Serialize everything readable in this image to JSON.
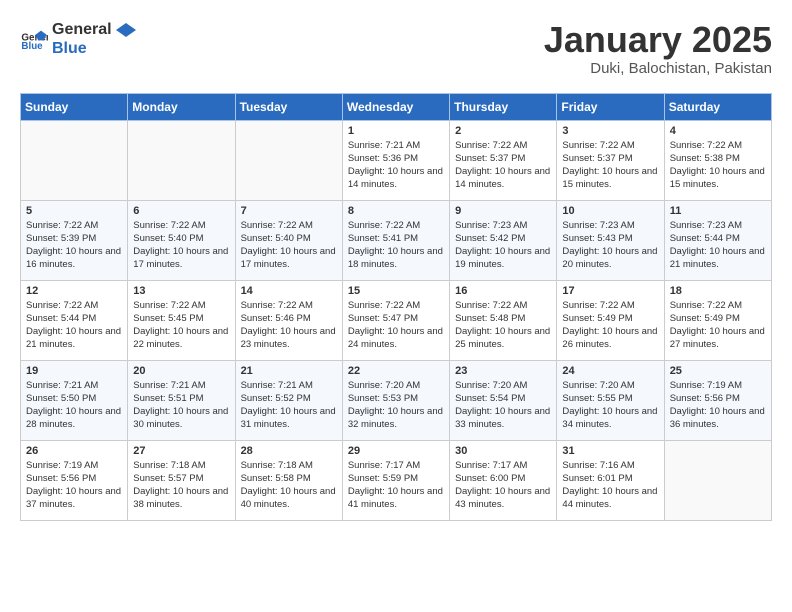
{
  "header": {
    "logo_general": "General",
    "logo_blue": "Blue",
    "title": "January 2025",
    "subtitle": "Duki, Balochistan, Pakistan"
  },
  "weekdays": [
    "Sunday",
    "Monday",
    "Tuesday",
    "Wednesday",
    "Thursday",
    "Friday",
    "Saturday"
  ],
  "weeks": [
    [
      {
        "day": "",
        "sunrise": "",
        "sunset": "",
        "daylight": ""
      },
      {
        "day": "",
        "sunrise": "",
        "sunset": "",
        "daylight": ""
      },
      {
        "day": "",
        "sunrise": "",
        "sunset": "",
        "daylight": ""
      },
      {
        "day": "1",
        "sunrise": "Sunrise: 7:21 AM",
        "sunset": "Sunset: 5:36 PM",
        "daylight": "Daylight: 10 hours and 14 minutes."
      },
      {
        "day": "2",
        "sunrise": "Sunrise: 7:22 AM",
        "sunset": "Sunset: 5:37 PM",
        "daylight": "Daylight: 10 hours and 14 minutes."
      },
      {
        "day": "3",
        "sunrise": "Sunrise: 7:22 AM",
        "sunset": "Sunset: 5:37 PM",
        "daylight": "Daylight: 10 hours and 15 minutes."
      },
      {
        "day": "4",
        "sunrise": "Sunrise: 7:22 AM",
        "sunset": "Sunset: 5:38 PM",
        "daylight": "Daylight: 10 hours and 15 minutes."
      }
    ],
    [
      {
        "day": "5",
        "sunrise": "Sunrise: 7:22 AM",
        "sunset": "Sunset: 5:39 PM",
        "daylight": "Daylight: 10 hours and 16 minutes."
      },
      {
        "day": "6",
        "sunrise": "Sunrise: 7:22 AM",
        "sunset": "Sunset: 5:40 PM",
        "daylight": "Daylight: 10 hours and 17 minutes."
      },
      {
        "day": "7",
        "sunrise": "Sunrise: 7:22 AM",
        "sunset": "Sunset: 5:40 PM",
        "daylight": "Daylight: 10 hours and 17 minutes."
      },
      {
        "day": "8",
        "sunrise": "Sunrise: 7:22 AM",
        "sunset": "Sunset: 5:41 PM",
        "daylight": "Daylight: 10 hours and 18 minutes."
      },
      {
        "day": "9",
        "sunrise": "Sunrise: 7:23 AM",
        "sunset": "Sunset: 5:42 PM",
        "daylight": "Daylight: 10 hours and 19 minutes."
      },
      {
        "day": "10",
        "sunrise": "Sunrise: 7:23 AM",
        "sunset": "Sunset: 5:43 PM",
        "daylight": "Daylight: 10 hours and 20 minutes."
      },
      {
        "day": "11",
        "sunrise": "Sunrise: 7:23 AM",
        "sunset": "Sunset: 5:44 PM",
        "daylight": "Daylight: 10 hours and 21 minutes."
      }
    ],
    [
      {
        "day": "12",
        "sunrise": "Sunrise: 7:22 AM",
        "sunset": "Sunset: 5:44 PM",
        "daylight": "Daylight: 10 hours and 21 minutes."
      },
      {
        "day": "13",
        "sunrise": "Sunrise: 7:22 AM",
        "sunset": "Sunset: 5:45 PM",
        "daylight": "Daylight: 10 hours and 22 minutes."
      },
      {
        "day": "14",
        "sunrise": "Sunrise: 7:22 AM",
        "sunset": "Sunset: 5:46 PM",
        "daylight": "Daylight: 10 hours and 23 minutes."
      },
      {
        "day": "15",
        "sunrise": "Sunrise: 7:22 AM",
        "sunset": "Sunset: 5:47 PM",
        "daylight": "Daylight: 10 hours and 24 minutes."
      },
      {
        "day": "16",
        "sunrise": "Sunrise: 7:22 AM",
        "sunset": "Sunset: 5:48 PM",
        "daylight": "Daylight: 10 hours and 25 minutes."
      },
      {
        "day": "17",
        "sunrise": "Sunrise: 7:22 AM",
        "sunset": "Sunset: 5:49 PM",
        "daylight": "Daylight: 10 hours and 26 minutes."
      },
      {
        "day": "18",
        "sunrise": "Sunrise: 7:22 AM",
        "sunset": "Sunset: 5:49 PM",
        "daylight": "Daylight: 10 hours and 27 minutes."
      }
    ],
    [
      {
        "day": "19",
        "sunrise": "Sunrise: 7:21 AM",
        "sunset": "Sunset: 5:50 PM",
        "daylight": "Daylight: 10 hours and 28 minutes."
      },
      {
        "day": "20",
        "sunrise": "Sunrise: 7:21 AM",
        "sunset": "Sunset: 5:51 PM",
        "daylight": "Daylight: 10 hours and 30 minutes."
      },
      {
        "day": "21",
        "sunrise": "Sunrise: 7:21 AM",
        "sunset": "Sunset: 5:52 PM",
        "daylight": "Daylight: 10 hours and 31 minutes."
      },
      {
        "day": "22",
        "sunrise": "Sunrise: 7:20 AM",
        "sunset": "Sunset: 5:53 PM",
        "daylight": "Daylight: 10 hours and 32 minutes."
      },
      {
        "day": "23",
        "sunrise": "Sunrise: 7:20 AM",
        "sunset": "Sunset: 5:54 PM",
        "daylight": "Daylight: 10 hours and 33 minutes."
      },
      {
        "day": "24",
        "sunrise": "Sunrise: 7:20 AM",
        "sunset": "Sunset: 5:55 PM",
        "daylight": "Daylight: 10 hours and 34 minutes."
      },
      {
        "day": "25",
        "sunrise": "Sunrise: 7:19 AM",
        "sunset": "Sunset: 5:56 PM",
        "daylight": "Daylight: 10 hours and 36 minutes."
      }
    ],
    [
      {
        "day": "26",
        "sunrise": "Sunrise: 7:19 AM",
        "sunset": "Sunset: 5:56 PM",
        "daylight": "Daylight: 10 hours and 37 minutes."
      },
      {
        "day": "27",
        "sunrise": "Sunrise: 7:18 AM",
        "sunset": "Sunset: 5:57 PM",
        "daylight": "Daylight: 10 hours and 38 minutes."
      },
      {
        "day": "28",
        "sunrise": "Sunrise: 7:18 AM",
        "sunset": "Sunset: 5:58 PM",
        "daylight": "Daylight: 10 hours and 40 minutes."
      },
      {
        "day": "29",
        "sunrise": "Sunrise: 7:17 AM",
        "sunset": "Sunset: 5:59 PM",
        "daylight": "Daylight: 10 hours and 41 minutes."
      },
      {
        "day": "30",
        "sunrise": "Sunrise: 7:17 AM",
        "sunset": "Sunset: 6:00 PM",
        "daylight": "Daylight: 10 hours and 43 minutes."
      },
      {
        "day": "31",
        "sunrise": "Sunrise: 7:16 AM",
        "sunset": "Sunset: 6:01 PM",
        "daylight": "Daylight: 10 hours and 44 minutes."
      },
      {
        "day": "",
        "sunrise": "",
        "sunset": "",
        "daylight": ""
      }
    ]
  ]
}
